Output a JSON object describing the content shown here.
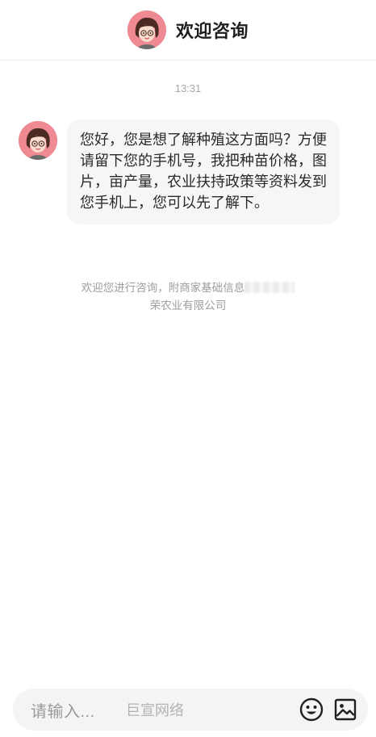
{
  "header": {
    "title": "欢迎咨询",
    "avatar_icon": "girl-avatar-icon"
  },
  "chat": {
    "timestamp": "13:31",
    "messages": [
      {
        "sender_avatar_icon": "girl-avatar-icon",
        "text": "您好，您是想了解种殖这方面吗？方便请留下您的手机号，我把种苗价格，图片，亩产量，农业扶持政策等资料发到您手机上，您可以先了解下。"
      }
    ],
    "notice": {
      "prefix": "欢迎您进行咨询，附商家基础信息",
      "suffix": "荣农业有限公司"
    }
  },
  "input": {
    "placeholder": "请输入...",
    "brand": "巨宣网络",
    "emoji_icon": "emoji-icon",
    "image_icon": "image-icon"
  },
  "colors": {
    "avatar_bg": "#ef8a93",
    "bubble_bg": "#f6f6f6",
    "input_bg": "#f4f4f4",
    "muted_text": "#9d9d9d"
  }
}
